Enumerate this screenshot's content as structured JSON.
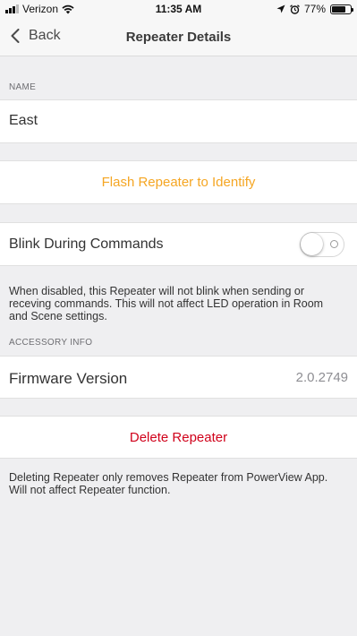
{
  "status_bar": {
    "carrier": "Verizon",
    "time": "11:35 AM",
    "battery": "77%",
    "battery_level": 0.77
  },
  "nav": {
    "back_label": "Back",
    "title": "Repeater Details"
  },
  "name_section": {
    "label": "NAME",
    "value": "East"
  },
  "identify": {
    "label": "Flash Repeater to Identify",
    "color": "#f5a623"
  },
  "blink": {
    "label": "Blink During Commands",
    "enabled": false,
    "note": "When disabled, this Repeater will not blink when sending or receving commands. This will not affect LED operation in Room and Scene settings."
  },
  "accessory": {
    "label": "ACCESSORY INFO",
    "firmware_label": "Firmware Version",
    "firmware_value": "2.0.2749"
  },
  "delete": {
    "label": "Delete Repeater",
    "color": "#d0021b",
    "note": "Deleting Repeater only removes Repeater from PowerView App. Will not affect Repeater function."
  },
  "icons": [
    "signal-icon",
    "wifi-icon",
    "location-icon",
    "alarm-icon",
    "battery-icon",
    "chevron-left-icon"
  ]
}
